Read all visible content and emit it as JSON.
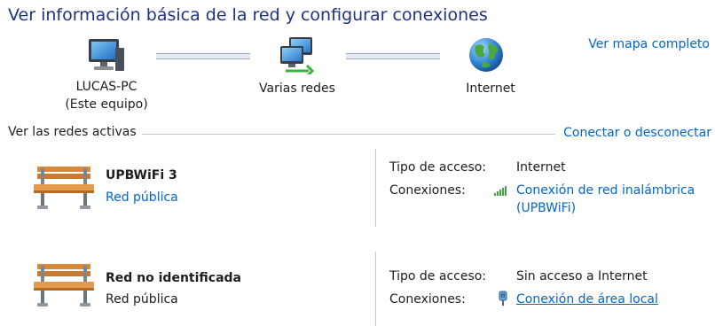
{
  "header": {
    "title": "Ver información básica de la red y configurar conexiones",
    "map_link": "Ver mapa completo"
  },
  "map": {
    "computer_name": "LUCAS-PC",
    "computer_sub": "(Este equipo)",
    "middle_label": "Varias redes",
    "internet_label": "Internet"
  },
  "active": {
    "section_label": "Ver las redes activas",
    "connect_link": "Conectar o desconectar",
    "access_type_label": "Tipo de acceso:",
    "connections_label": "Conexiones:",
    "networks": [
      {
        "name": "UPBWiFi  3",
        "category": "Red pública",
        "access": "Internet",
        "connection_line1": "Conexión de red inalámbrica",
        "connection_line2": "(UPBWiFi)"
      },
      {
        "name": "Red no identificada",
        "category": "Red pública",
        "access": "Sin acceso a Internet",
        "connection": "Conexión de área local"
      }
    ]
  }
}
